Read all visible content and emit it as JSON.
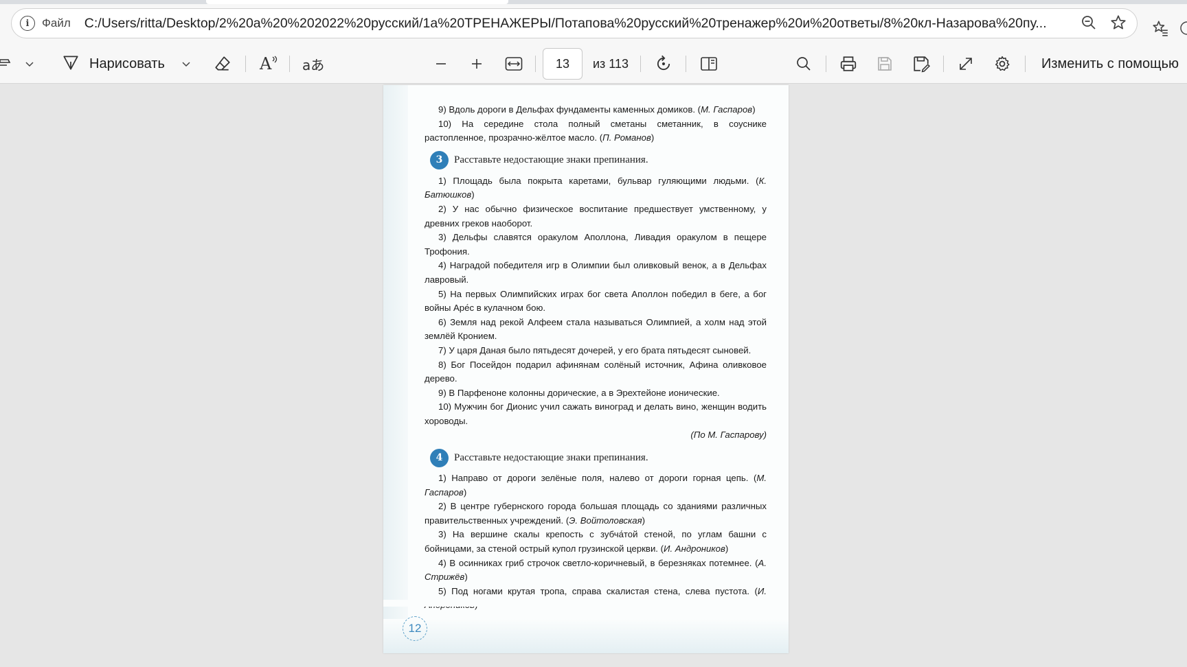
{
  "browser": {
    "file_label": "Файл",
    "url": "C:/Users/ritta/Desktop/2%20a%20%202022%20русский/1a%20ТРЕНАЖЕРЫ/Потапова%20русский%20тренажер%20и%20ответы/8%20кл-Назарова%20пу..."
  },
  "toolbar": {
    "draw_label": "Нарисовать",
    "translate_glyph": "aあ",
    "read_aloud_glyph": "A",
    "page_current": "13",
    "page_total_label": "из 113",
    "edit_with_label": "Изменить с помощью"
  },
  "document": {
    "top_lines": [
      {
        "text": "9) Вдоль дороги в Дельфах фундаменты каменных домиков. (",
        "author": "М. Гаспаров",
        "close": ")"
      },
      {
        "text": "10) На середине стола полный сметаны сметанник, в соуснике растопленное, прозрачно-жёлтое масло. (",
        "author": "П. Романов",
        "close": ")"
      }
    ],
    "section3": {
      "number": "3",
      "title": "Расставьте недостающие знаки препинания.",
      "items": [
        {
          "text": "1) Площадь была покрыта каретами, бульвар гуляющими людьми. (",
          "author": "К. Батюшков",
          "close": ")"
        },
        {
          "text": "2) У нас обычно физическое воспитание предшествует умственному, у древних греков наоборот.",
          "author": "",
          "close": ""
        },
        {
          "text": "3) Дельфы славятся оракулом Аполлона, Ливадия оракулом в пещере Трофония.",
          "author": "",
          "close": ""
        },
        {
          "text": "4) Наградой победителя игр в Олимпии был оливковый венок, а в Дельфах лавровый.",
          "author": "",
          "close": ""
        },
        {
          "text": "5) На первых Олимпийских играх бог света Аполлон победил в беге, а бог войны Аре́с в кулачном бою.",
          "author": "",
          "close": ""
        },
        {
          "text": "6) Земля над рекой Алфеем стала называться Олимпией, а холм над этой землёй Кронием.",
          "author": "",
          "close": ""
        },
        {
          "text": "7) У царя Даная было пятьдесят дочерей, у его брата пятьдесят сыновей.",
          "author": "",
          "close": ""
        },
        {
          "text": "8) Бог Посейдон подарил афинянам солёный источник, Афина оливковое дерево.",
          "author": "",
          "close": ""
        },
        {
          "text": "9) В Парфеноне колонны дорические, а в Эрехтейоне ионические.",
          "author": "",
          "close": ""
        },
        {
          "text": "10) Мужчин бог Дионис учил сажать виноград и делать вино, женщин водить хороводы.",
          "author": "",
          "close": ""
        }
      ],
      "signature": "(По М. Гаспарову)"
    },
    "section4": {
      "number": "4",
      "title": "Расставьте недостающие знаки препинания.",
      "items": [
        {
          "text": "1) Направо от дороги зелёные поля, налево от дороги горная цепь. (",
          "author": "М. Гаспаров",
          "close": ")"
        },
        {
          "text": "2) В центре губернского города большая площадь со зданиями различных правительственных учреждений. (",
          "author": "Э. Войтоловская",
          "close": ")"
        },
        {
          "text": "3) На вершине скалы крепость с зубча́той стеной, по углам башни с бойницами, за стеной острый купол грузинской церкви. (",
          "author": "И. Андроников",
          "close": ")"
        },
        {
          "text": "4) В осинниках гриб строчок светло-коричневый, в березняках потемнее. (",
          "author": "А. Стрижёв",
          "close": ")"
        },
        {
          "text": "5) Под ногами крутая тропа, справа скалистая стена, слева пустота. (",
          "author": "И. Андроников",
          "close": ")"
        }
      ]
    },
    "page_number": "12"
  }
}
